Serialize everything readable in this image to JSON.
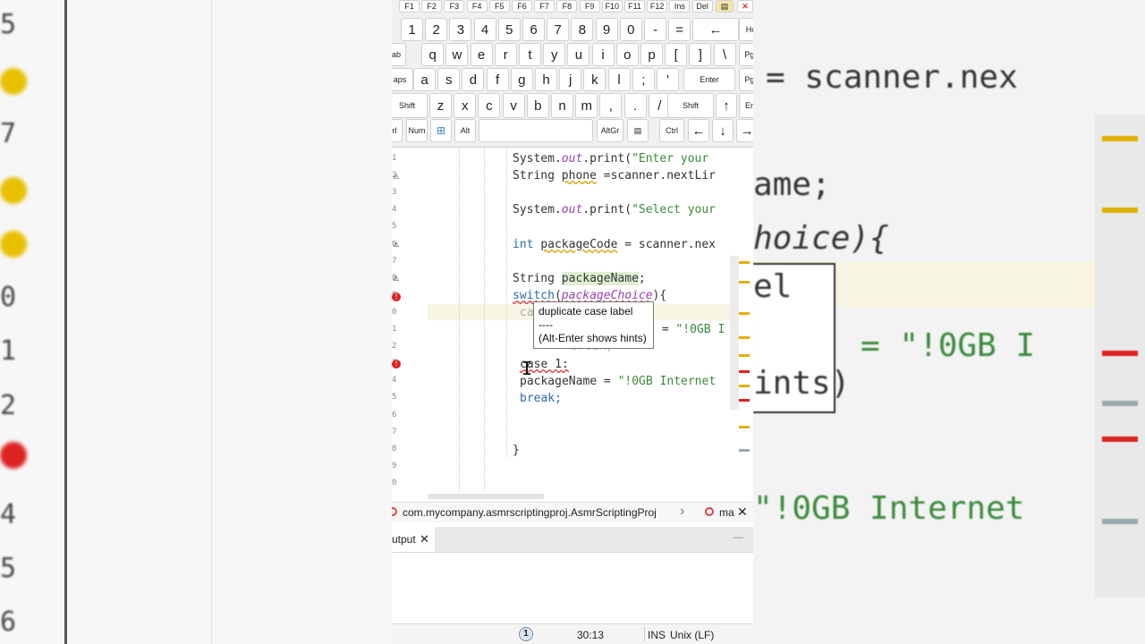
{
  "keyboard": {
    "row_fn": [
      "F1",
      "F2",
      "F3",
      "F4",
      "F5",
      "F6",
      "F7",
      "F8",
      "F9",
      "F10",
      "F11",
      "F12",
      "Ins",
      "Del"
    ],
    "row_num": [
      "1",
      "2",
      "3",
      "4",
      "5",
      "6",
      "7",
      "8",
      "9",
      "0",
      "-",
      "=",
      "←",
      "Hor"
    ],
    "row_q": [
      "ab",
      "q",
      "w",
      "e",
      "r",
      "t",
      "y",
      "u",
      "i",
      "o",
      "p",
      "[",
      "]",
      "\\",
      "PgU"
    ],
    "row_a": [
      "aps",
      "a",
      "s",
      "d",
      "f",
      "g",
      "h",
      "j",
      "k",
      "l",
      ";",
      "'",
      "Enter",
      "PgD"
    ],
    "row_z": [
      "Shift",
      "z",
      "x",
      "c",
      "v",
      "b",
      "n",
      "m",
      ",",
      ".",
      "/",
      "Shift",
      "↑",
      "End"
    ],
    "row_bottom": {
      "ctrl_left": "rl",
      "num": "Num",
      "alt": "Alt",
      "altgr": "AltGr",
      "ctrl": "Ctrl",
      "left": "←",
      "down": "↓",
      "right": "→"
    },
    "close_label": "✕"
  },
  "editor": {
    "line_numbers": [
      "1",
      "2",
      "3",
      "4",
      "5",
      "6",
      "7",
      "8",
      "9",
      "0",
      "1",
      "2",
      "3",
      "4",
      "5",
      "6",
      "7",
      "8",
      "9",
      "0"
    ],
    "code": {
      "l1_a": "System.",
      "l1_b": "out",
      "l1_c": ".print(",
      "l1_d": "\"Enter your",
      "l2_a": "String ",
      "l2_b": "phone",
      "l2_c": " =scanner.nextLir",
      "l4_a": "System.",
      "l4_b": "out",
      "l4_c": ".print(",
      "l4_d": "\"Select your",
      "l6_a": "int",
      "l6_b": " ",
      "l6_c": "packageCode",
      "l6_d": " = scanner.nex",
      "l8_a": "String ",
      "l8_b": "packageName",
      "l8_c": ";",
      "l9_a": "switch",
      "l9_b": "(",
      "l9_c": "packageChoice",
      "l9_d": "){",
      "l10": "ca",
      "l11_a": " = ",
      "l11_b": "\"!0GB I",
      "l12": "break;",
      "l13_a": "case 1",
      "l13_b": ":",
      "l14_a": "packageName = ",
      "l14_b": "\"!0GB Internet",
      "l15": "break;",
      "l18": "}"
    },
    "tooltip": {
      "title": "duplicate case label",
      "divider": "----",
      "hint": "(Alt-Enter shows hints)"
    }
  },
  "breadcrumb": {
    "path": "com.mycompany.asmrscriptingproj.AsmrScriptingProj",
    "separator": "›",
    "method": "ma",
    "close": "✕"
  },
  "output": {
    "tab_label": "utput",
    "close": "✕",
    "minimize": "—"
  },
  "status": {
    "notifications": "1",
    "position": "30:13",
    "mode": "INS",
    "line_endings": "Unix (LF)"
  },
  "background": {
    "left_numbers": [
      "5",
      "7",
      "0",
      "1",
      "2",
      "4",
      "5",
      "6"
    ],
    "right_line1": "= scanner.nex",
    "right_line2": "ame;",
    "right_line3": "hoice){",
    "right_line4": "el",
    "right_line5": "= \"!0GB I",
    "right_line6": "ints)",
    "right_line7": "\"!0GB Internet"
  },
  "colors": {
    "keyword": "#2a6ab0",
    "field": "#9a3fb5",
    "string": "#3a8a3a",
    "error": "#d22222",
    "warning": "#d9a000"
  }
}
